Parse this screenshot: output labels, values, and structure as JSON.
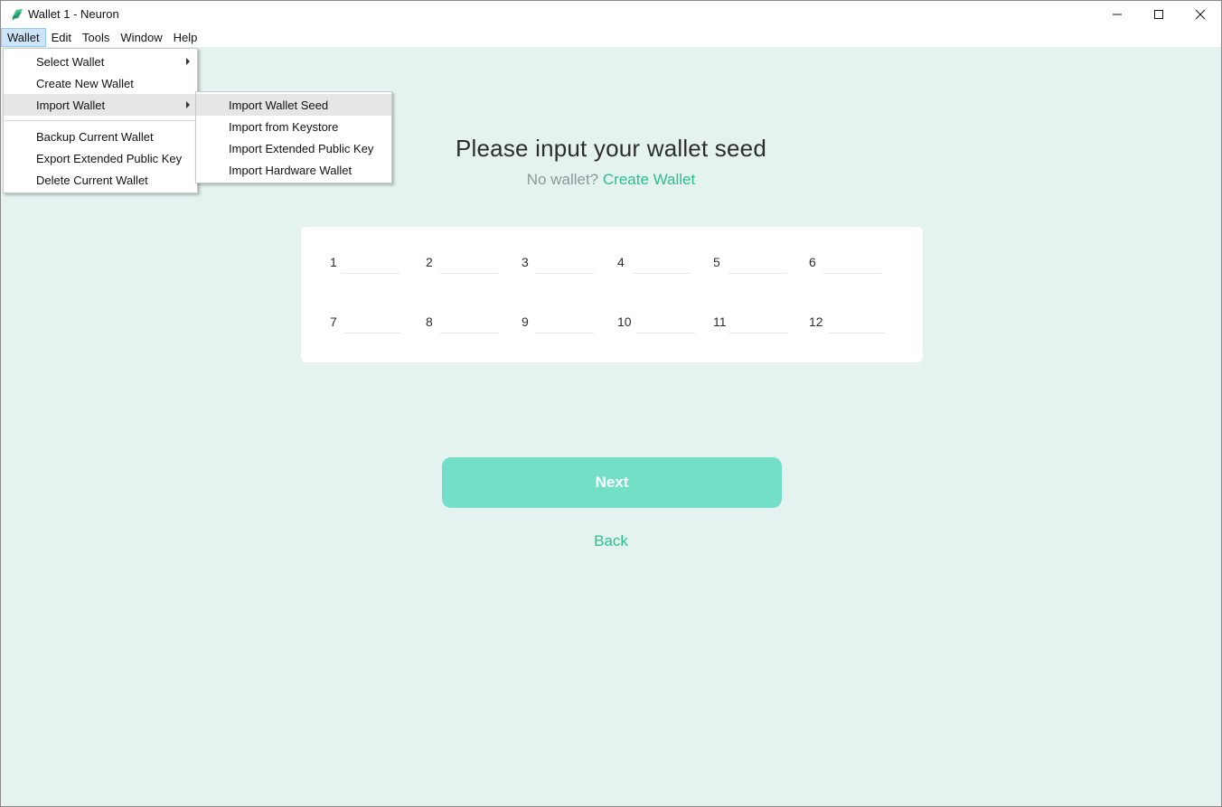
{
  "window": {
    "title": "Wallet 1 - Neuron",
    "controls": {
      "minimize": "—",
      "maximize": "☐",
      "close": "✕"
    }
  },
  "menubar": {
    "items": [
      "Wallet",
      "Edit",
      "Tools",
      "Window",
      "Help"
    ]
  },
  "wallet_menu": {
    "items": [
      "Select Wallet",
      "Create New Wallet",
      "Import Wallet",
      "Backup Current Wallet",
      "Export Extended Public Key",
      "Delete Current Wallet"
    ]
  },
  "import_submenu": {
    "items": [
      "Import Wallet Seed",
      "Import from Keystore",
      "Import Extended Public Key",
      "Import Hardware Wallet"
    ]
  },
  "page": {
    "heading": "Please input your wallet seed",
    "no_wallet": "No wallet?",
    "create_wallet": "Create Wallet",
    "seed_numbers": [
      "1",
      "2",
      "3",
      "4",
      "5",
      "6",
      "7",
      "8",
      "9",
      "10",
      "11",
      "12"
    ],
    "next_label": "Next",
    "back_label": "Back"
  },
  "colors": {
    "accent": "#2bbf8e",
    "button": "#72dfc6",
    "background": "#e4f2f0"
  }
}
